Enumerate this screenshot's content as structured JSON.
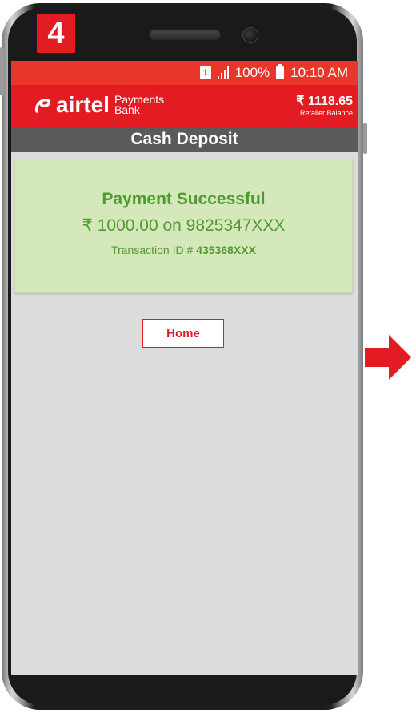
{
  "step_number": "4",
  "status_bar": {
    "sim_slot": "1",
    "battery_percent": "100%",
    "time": "10:10 AM"
  },
  "app_bar": {
    "brand": "airtel",
    "brand_sub_line1": "Payments",
    "brand_sub_line2": "Bank",
    "balance_amount": "₹ 1118.65",
    "balance_label": "Retailer Balance"
  },
  "screen_title": "Cash Deposit",
  "result": {
    "title": "Payment Successful",
    "amount_line": "₹ 1000.00 on 9825347XXX",
    "txn_label": "Transaction ID #",
    "txn_id": "435368XXX"
  },
  "home_button_label": "Home",
  "colors": {
    "brand_red": "#e31b23",
    "success_green": "#4d9a2f",
    "success_bg": "#d5e8bb"
  },
  "icons": [
    "sim-icon",
    "signal-icon",
    "battery-icon",
    "airtel-logo-icon",
    "next-arrow-icon"
  ]
}
